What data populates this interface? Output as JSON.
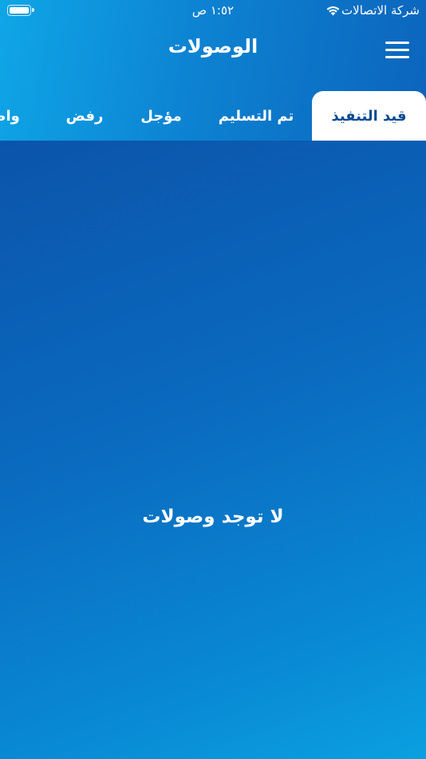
{
  "status_bar": {
    "carrier": "شركة الاتصالات",
    "time": "١:٥٢ ص",
    "wifi_icon": "wifi-icon",
    "battery_icon": "battery-icon"
  },
  "header": {
    "title": "الوصولات",
    "menu_icon": "hamburger-menu-icon"
  },
  "tabs": [
    {
      "label": "قيد التنفيذ",
      "active": true
    },
    {
      "label": "تم التسليم",
      "active": false
    },
    {
      "label": "مؤجل",
      "active": false
    },
    {
      "label": "رفض",
      "active": false
    },
    {
      "label": "واصل",
      "active": false
    }
  ],
  "empty_state": {
    "message": "لا توجد وصولات"
  },
  "colors": {
    "active_tab_text": "#0b4a93",
    "active_tab_bg": "#ffffff",
    "header_gradient_start": "#0fa6e6",
    "header_gradient_end": "#0c64bc",
    "body_gradient_start": "#0b54ab",
    "body_gradient_end": "#0aa0e0"
  }
}
